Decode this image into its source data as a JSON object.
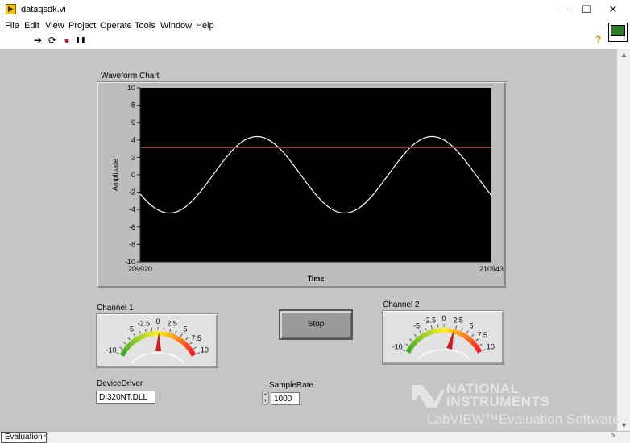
{
  "window": {
    "title": "dataqsdk.vi",
    "minimize_glyph": "—",
    "maximize_glyph": "☐",
    "close_glyph": "✕"
  },
  "menu": [
    "File",
    "Edit",
    "View",
    "Project",
    "Operate",
    "Tools",
    "Window",
    "Help"
  ],
  "toolbar": {
    "tools": [
      {
        "name": "run-arrow-icon",
        "glyph": "➔"
      },
      {
        "name": "run-continuously-icon",
        "glyph": "⟳"
      },
      {
        "name": "abort-icon",
        "glyph": "●"
      },
      {
        "name": "pause-icon",
        "glyph": "❚❚"
      }
    ],
    "help_glyph": "?",
    "vi_icon_number": "1"
  },
  "waveform_chart": {
    "label": "Waveform Chart",
    "chart_data": {
      "type": "line",
      "xlabel": "Time",
      "ylabel": "Amplitude",
      "xlim": [
        209920,
        210943
      ],
      "ylim": [
        -10,
        10
      ],
      "x_tick_labels": [
        "209920",
        "210943"
      ],
      "y_ticks": [
        10,
        8,
        6,
        4,
        2,
        0,
        -2,
        -4,
        -6,
        -8,
        -10
      ],
      "grid": false,
      "background": "#000000",
      "series": [
        {
          "shape": "sine",
          "amplitude": 4.4,
          "period": 510,
          "start_value": -2.2,
          "start_phase_deg": 210,
          "color": "#ffffff"
        },
        {
          "shape": "constant",
          "value": 3.1,
          "color": "#cc2020"
        }
      ]
    }
  },
  "gauges": [
    {
      "label": "Channel 1",
      "value": 0.2,
      "min": -10,
      "max": 10,
      "tick_labels": [
        "-10",
        "-5",
        "-2.5",
        "0",
        "2.5",
        "5",
        "7.5",
        "10"
      ]
    },
    {
      "label": "Channel 2",
      "value": 2.2,
      "min": -10,
      "max": 10,
      "tick_labels": [
        "-10",
        "-5",
        "-2.5",
        "0",
        "2.5",
        "5",
        "7.5",
        "10"
      ]
    }
  ],
  "stop_button": {
    "label": "Stop"
  },
  "device_driver": {
    "label": "DeviceDriver",
    "value": "DI320NT.DLL"
  },
  "sample_rate": {
    "label": "SampleRate",
    "value": "1000"
  },
  "logo": {
    "line1": "NATIONAL",
    "line2": "INSTRUMENTS",
    "line3": "LabVIEW™Evaluation Software"
  },
  "status": {
    "tab": "Evaluation",
    "left_arrow": "<",
    "right_arrow": ">"
  },
  "scroll": {
    "up": "▲",
    "down": "▼"
  }
}
